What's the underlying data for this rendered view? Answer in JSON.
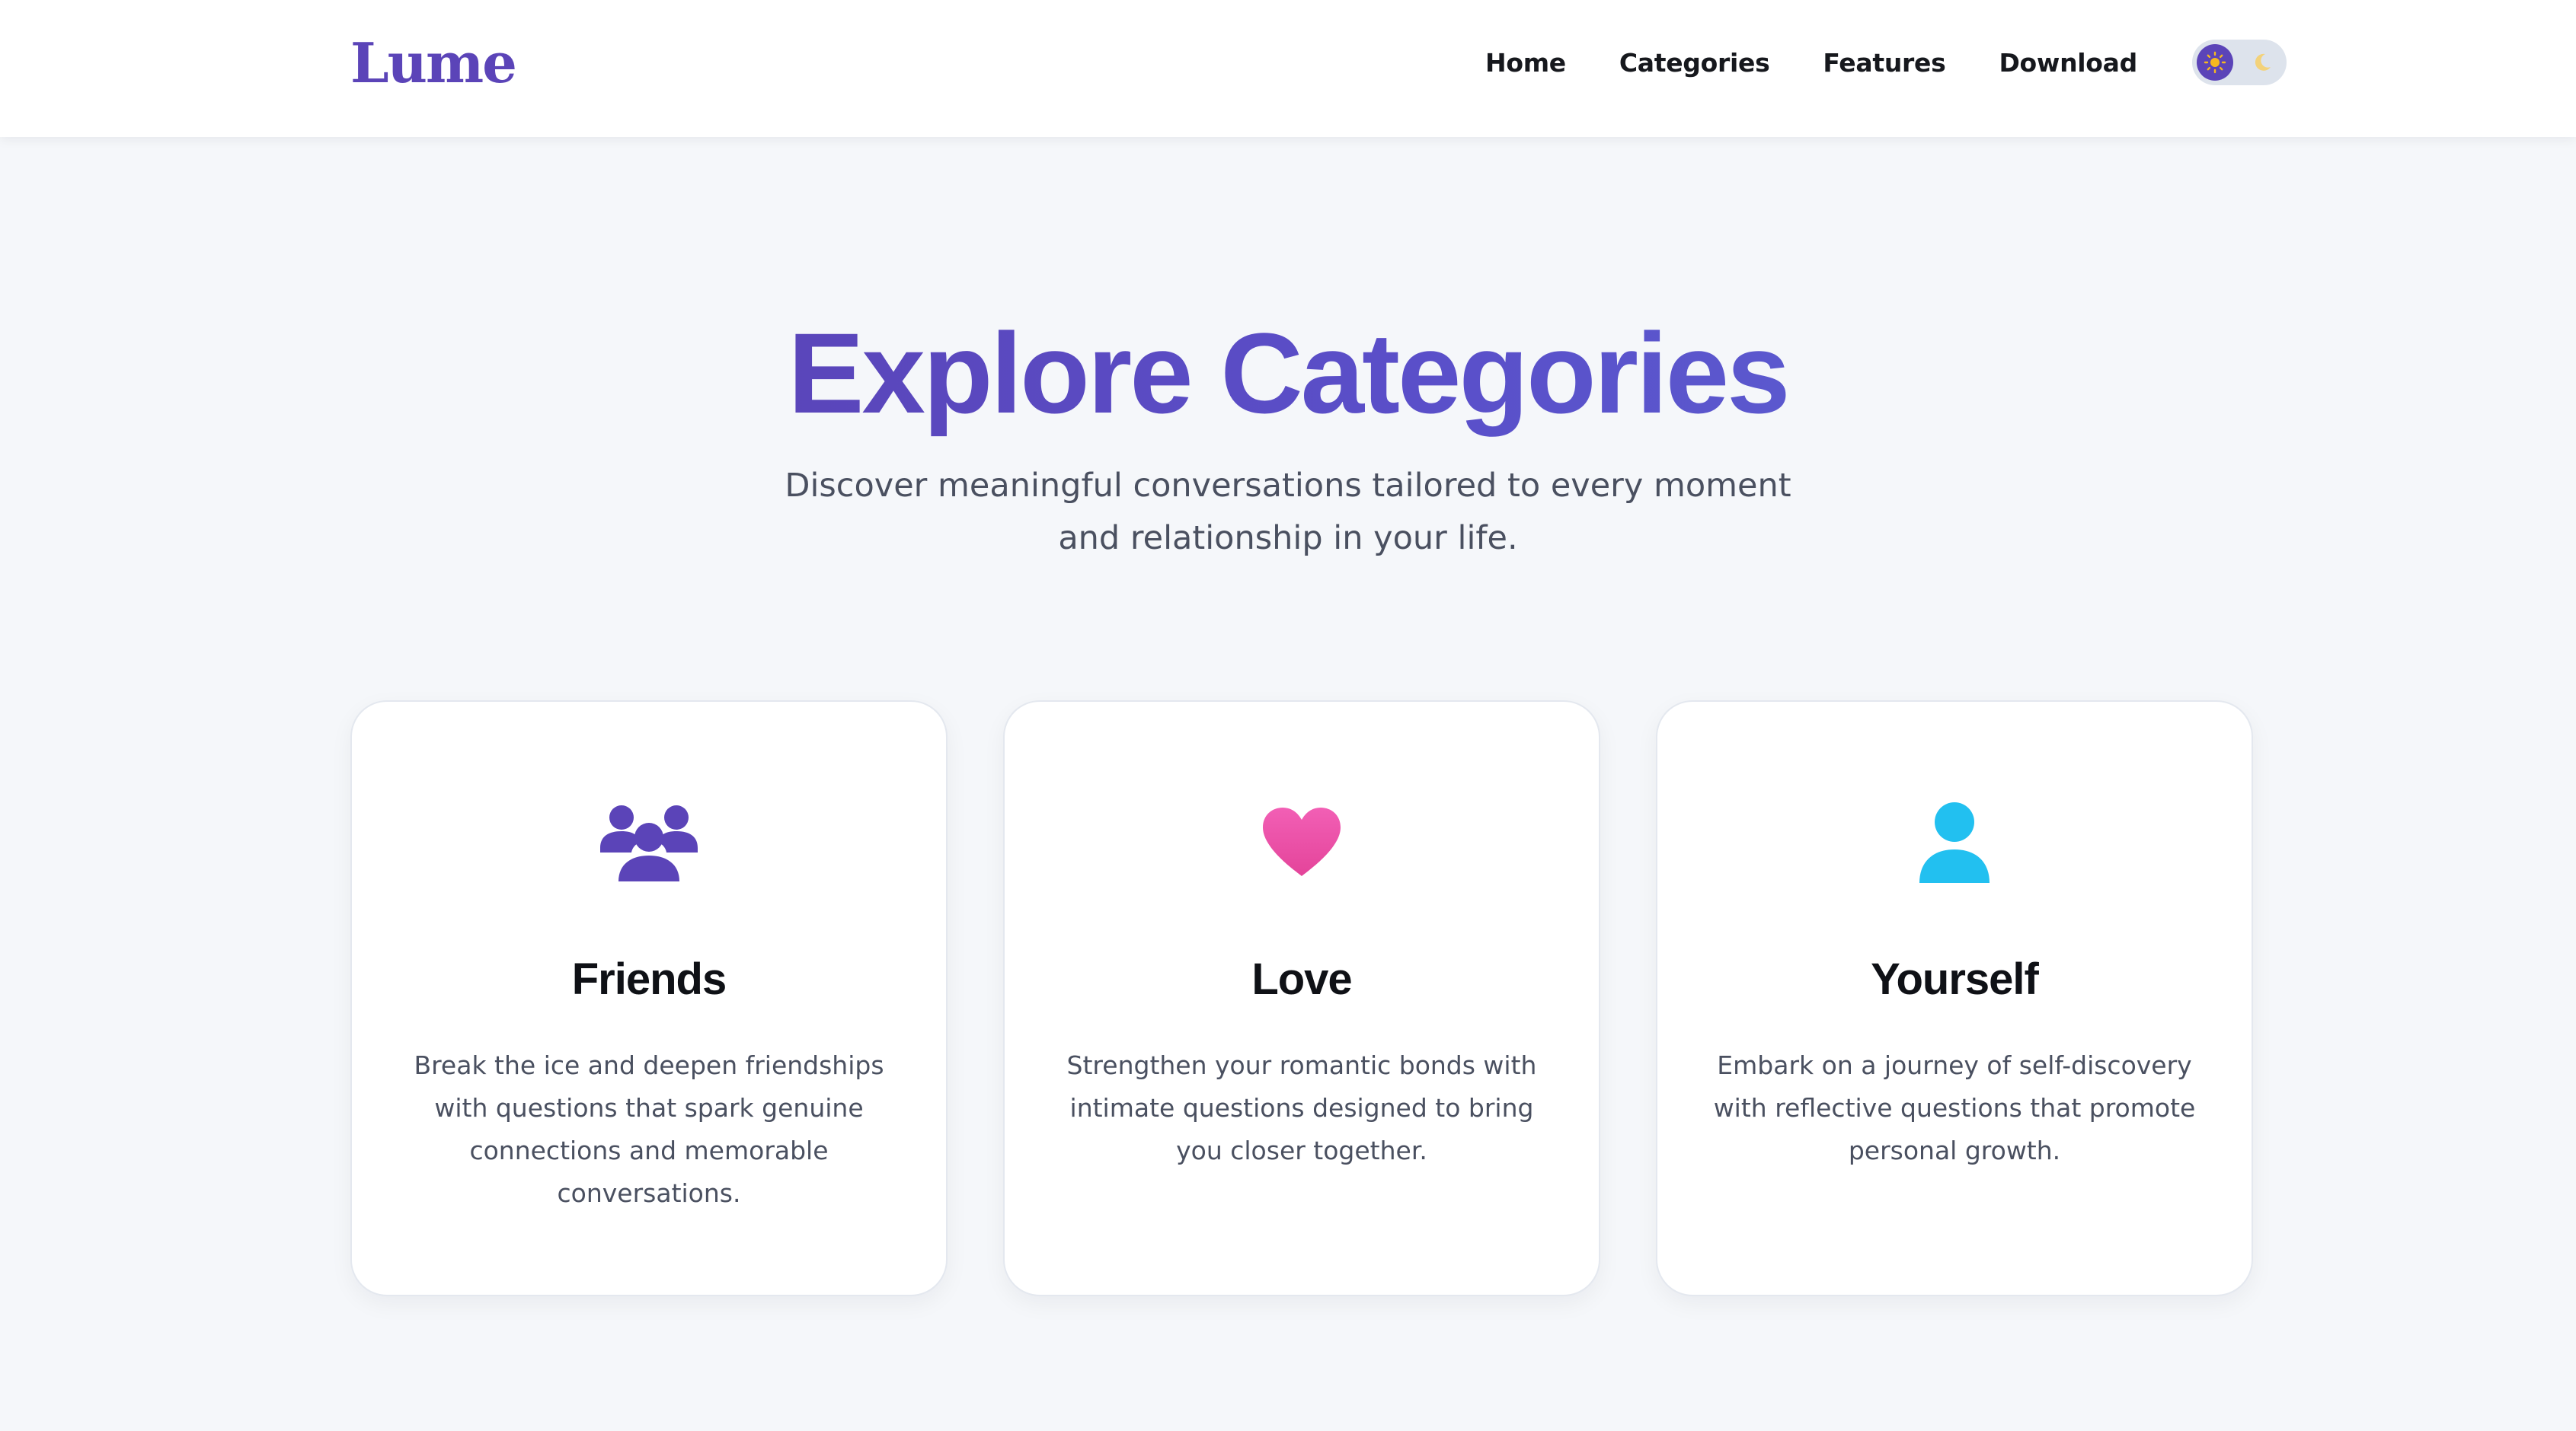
{
  "brand": {
    "logo_text": "Lume",
    "accent_color": "#5b44b8"
  },
  "nav": {
    "items": [
      {
        "label": "Home"
      },
      {
        "label": "Categories"
      },
      {
        "label": "Features"
      },
      {
        "label": "Download"
      }
    ],
    "theme_toggle": {
      "state": "light",
      "light_icon": "sun-icon",
      "dark_icon": "moon-icon"
    }
  },
  "hero": {
    "title": "Explore Categories",
    "subtitle_line1": "Discover meaningful conversations tailored to every moment",
    "subtitle_line2": "and relationship in your life."
  },
  "categories": [
    {
      "title": "Friends",
      "icon": "users-icon",
      "icon_color": "#5b44b8",
      "description": "Break the ice and deepen friendships with questions that spark genuine connections and memorable conversations."
    },
    {
      "title": "Love",
      "icon": "heart-icon",
      "icon_color": "#ec4899",
      "description": "Strengthen your romantic bonds with intimate questions designed to bring you closer together."
    },
    {
      "title": "Yourself",
      "icon": "user-icon",
      "icon_color": "#22c0f0",
      "description": "Embark on a journey of self-discovery with reflective questions that promote personal growth."
    }
  ]
}
